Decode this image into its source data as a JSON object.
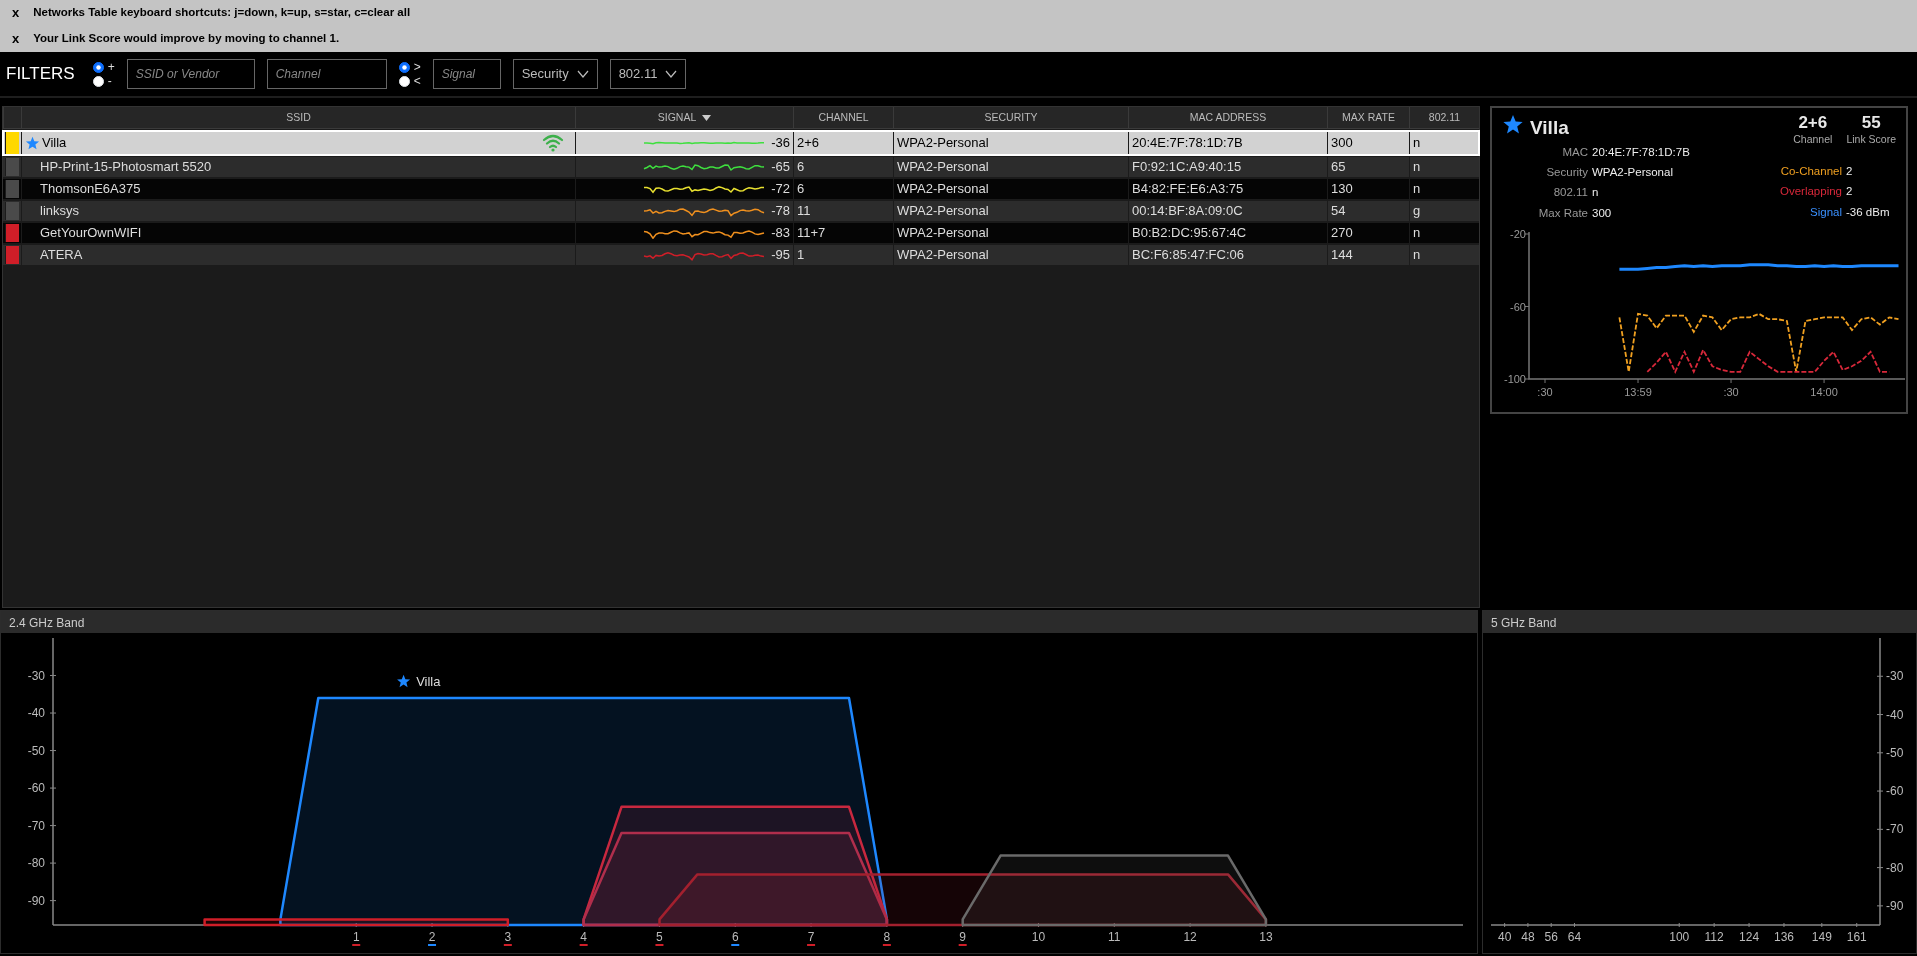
{
  "notifications": [
    {
      "close": "x",
      "text": "Networks Table keyboard shortcuts: j=down, k=up, s=star, c=clear all"
    },
    {
      "close": "x",
      "text": "Your Link Score would improve by moving to channel 1."
    }
  ],
  "filters": {
    "title": "FILTERS",
    "ssid_sign": [
      {
        "label": "+",
        "selected": true
      },
      {
        "label": "-",
        "selected": false
      }
    ],
    "ssid_field": {
      "placeholder": "SSID or Vendor"
    },
    "channel_field": {
      "placeholder": "Channel"
    },
    "signal_sign": [
      {
        "label": ">",
        "selected": true
      },
      {
        "label": "<",
        "selected": false
      }
    ],
    "signal_field": {
      "placeholder": "Signal"
    },
    "dropdowns": [
      "Security",
      "802.11"
    ]
  },
  "table": {
    "columns": [
      {
        "label": "SSID",
        "sorted": false
      },
      {
        "label": "SIGNAL",
        "sorted": true
      },
      {
        "label": "CHANNEL",
        "sorted": false
      },
      {
        "label": "SECURITY",
        "sorted": false
      },
      {
        "label": "MAC ADDRESS",
        "sorted": false
      },
      {
        "label": "MAX RATE",
        "sorted": false
      },
      {
        "label": "802.11",
        "sorted": false
      }
    ],
    "rows": [
      {
        "selected": true,
        "color": "#ffd800",
        "starred": true,
        "ssid": "Villa",
        "connected": true,
        "trace": {
          "color": "#3ee03e"
        },
        "signal": "-36",
        "channel": "2+6",
        "security": "WPA2-Personal",
        "mac": "20:4E:7F:78:1D:7B",
        "max_rate": "300",
        "phy": "n"
      },
      {
        "selected": false,
        "color": "#4a4a4a",
        "starred": false,
        "ssid": "HP-Print-15-Photosmart 5520",
        "connected": false,
        "trace": {
          "color": "#3ee03e"
        },
        "signal": "-65",
        "channel": "6",
        "security": "WPA2-Personal",
        "mac": "F0:92:1C:A9:40:15",
        "max_rate": "65",
        "phy": "n"
      },
      {
        "selected": false,
        "color": "#4a4a4a",
        "starred": false,
        "ssid": "ThomsonE6A375",
        "connected": false,
        "trace": {
          "color": "#e8e030"
        },
        "signal": "-72",
        "channel": "6",
        "security": "WPA2-Personal",
        "mac": "B4:82:FE:E6:A3:75",
        "max_rate": "130",
        "phy": "n"
      },
      {
        "selected": false,
        "color": "#4a4a4a",
        "starred": false,
        "ssid": "linksys",
        "connected": false,
        "trace": {
          "color": "#f0901e"
        },
        "signal": "-78",
        "channel": "11",
        "security": "WPA2-Personal",
        "mac": "00:14:BF:8A:09:0C",
        "max_rate": "54",
        "phy": "g"
      },
      {
        "selected": false,
        "color": "#d01e28",
        "starred": false,
        "ssid": "GetYourOwnWIFI",
        "connected": false,
        "trace": {
          "color": "#f0901e"
        },
        "signal": "-83",
        "channel": "11+7",
        "security": "WPA2-Personal",
        "mac": "B0:B2:DC:95:67:4C",
        "max_rate": "270",
        "phy": "n"
      },
      {
        "selected": false,
        "color": "#d01e28",
        "starred": false,
        "ssid": "ATERA",
        "connected": false,
        "trace": {
          "color": "#d01e28"
        },
        "signal": "-95",
        "channel": "1",
        "security": "WPA2-Personal",
        "mac": "BC:F6:85:47:FC:06",
        "max_rate": "144",
        "phy": "n"
      }
    ]
  },
  "details": {
    "starred": true,
    "ssid": "Villa",
    "channel": "2+6",
    "channel_label": "Channel",
    "link_score": "55",
    "link_score_label": "Link Score",
    "fields": [
      {
        "label": "MAC",
        "value": "20:4E:7F:78:1D:7B"
      },
      {
        "label": "Security",
        "value": "WPA2-Personal"
      },
      {
        "label": "802.11",
        "value": "n"
      },
      {
        "label": "Max Rate",
        "value": "300"
      }
    ],
    "stats": [
      {
        "label": "Co-Channel",
        "value": "2",
        "color": "#f0a020"
      },
      {
        "label": "Overlapping",
        "value": "2",
        "color": "#d8283a"
      },
      {
        "label": "Signal",
        "value": "-36 dBm",
        "color": "#3a90ff"
      }
    ],
    "chart_data": {
      "type": "line",
      "ylim": [
        -100,
        -20
      ],
      "yticks": [
        -20,
        -60,
        -100
      ],
      "categories": [
        ":30",
        null,
        null,
        null,
        null,
        null,
        null,
        null,
        null,
        null,
        "13:59",
        null,
        null,
        null,
        null,
        null,
        null,
        null,
        null,
        null,
        ":30",
        null,
        null,
        null,
        null,
        null,
        null,
        null,
        null,
        null,
        "14:00",
        null,
        null,
        null,
        null,
        null,
        null,
        null,
        null
      ],
      "series": [
        {
          "color": "#1e88ff",
          "line_style": "solid",
          "values": [
            null,
            null,
            null,
            null,
            null,
            null,
            null,
            null,
            -39.5,
            -39.5,
            -39.5,
            -39,
            -38.5,
            -38.5,
            -38,
            -37.5,
            -38,
            -37.5,
            -38,
            -37.5,
            -37.5,
            -37.5,
            -37,
            -37,
            -37,
            -37.5,
            -37.5,
            -38,
            -38,
            -37.5,
            -38,
            -37.5,
            -38,
            -38,
            -37.5,
            -37.5,
            -37.5,
            -37.5,
            -37.5
          ]
        },
        {
          "color": "#f0a020",
          "line_style": "dashed",
          "values": [
            null,
            null,
            null,
            null,
            null,
            null,
            null,
            null,
            -66,
            -96,
            -64,
            -65,
            -72,
            -65,
            -65,
            -65,
            -74,
            -65,
            -66,
            -73,
            -67,
            -66,
            -66,
            -64,
            -67,
            -67,
            -68,
            -96,
            -68,
            -67,
            -66,
            -66,
            -66,
            -73,
            -67,
            -66,
            -70,
            -66,
            -67
          ]
        },
        {
          "color": "#d8283a",
          "line_style": "dashed",
          "values": [
            null,
            null,
            null,
            null,
            null,
            null,
            null,
            null,
            null,
            null,
            null,
            -96,
            -91,
            -85,
            -96,
            -85,
            -96,
            -84,
            -93,
            -95,
            -96,
            -96,
            -85,
            -89,
            -93,
            -96,
            -96,
            -96,
            -96,
            -96,
            -90,
            -85,
            -95,
            -93,
            -90,
            -85,
            -96,
            -96,
            null
          ]
        }
      ]
    }
  },
  "band_24": {
    "title": "2.4 GHz Band",
    "annotation_marks": [
      {
        "starred": true
      }
    ],
    "channel_marks": [
      {
        "color": "#d01e28"
      },
      {
        "color": "#1e88ff"
      },
      {
        "color": "#d01e28"
      },
      {
        "color": "#d01e28"
      },
      {
        "color": "#d01e28"
      },
      {
        "color": "#1e88ff"
      },
      {
        "color": "#d01e28"
      },
      {
        "color": "#d01e28"
      },
      {
        "color": "#d01e28"
      }
    ],
    "chart_data": {
      "type": "area",
      "xlim": [
        -3,
        15.6
      ],
      "ylim": [
        -96.5,
        -20
      ],
      "yticks": [
        -30,
        -40,
        -50,
        -60,
        -70,
        -80,
        -90
      ],
      "xticks": [
        1,
        2,
        3,
        4,
        5,
        6,
        7,
        8,
        9,
        10,
        11,
        12,
        13
      ],
      "x": [
        -1,
        -0.5,
        0,
        0.5,
        1,
        1.5,
        2,
        2.5,
        3,
        3.5,
        4,
        4.5,
        5,
        5.5,
        6,
        6.5,
        7,
        7.5,
        8,
        8.5,
        9,
        9.5,
        10,
        10.5,
        11,
        11.5,
        12,
        12.5,
        13
      ],
      "series": [
        {
          "color": "#1e88ff",
          "values": [
            null,
            null,
            -95,
            -36,
            -36,
            -36,
            -36,
            -36,
            -36,
            -36,
            -36,
            -36,
            -36,
            -36,
            -36,
            -36,
            -36,
            -36,
            -95,
            null,
            null,
            null,
            null,
            null,
            null,
            null,
            null,
            null,
            null
          ]
        },
        {
          "color": "#c8283f",
          "values": [
            null,
            null,
            null,
            null,
            null,
            null,
            null,
            null,
            null,
            null,
            -95,
            -65,
            -65,
            -65,
            -65,
            -65,
            -65,
            -65,
            -95,
            null,
            null,
            null,
            null,
            null,
            null,
            null,
            null,
            null,
            null
          ]
        },
        {
          "color": "#b02e4c",
          "values": [
            null,
            null,
            null,
            null,
            null,
            null,
            null,
            null,
            null,
            null,
            -95,
            -72,
            -72,
            -72,
            -72,
            -72,
            -72,
            -72,
            -95,
            null,
            null,
            null,
            null,
            null,
            null,
            null,
            null,
            null,
            null
          ]
        },
        {
          "color": "#a3202e",
          "values": [
            null,
            null,
            null,
            null,
            null,
            null,
            null,
            null,
            null,
            null,
            null,
            null,
            -95,
            -83,
            -83,
            -83,
            -83,
            -83,
            -83,
            -83,
            -83,
            -83,
            -83,
            -83,
            -83,
            -83,
            -83,
            -83,
            -95
          ]
        },
        {
          "color": "#6a6a6a",
          "values": [
            null,
            null,
            null,
            null,
            null,
            null,
            null,
            null,
            null,
            null,
            null,
            null,
            null,
            null,
            null,
            null,
            null,
            null,
            null,
            null,
            -95,
            -78,
            -78,
            -78,
            -78,
            -78,
            -78,
            -78,
            -95
          ]
        },
        {
          "color": "#d01e28",
          "values": [
            -95,
            -95,
            -95,
            -95,
            -95,
            -95,
            -95,
            -95,
            -95,
            null,
            null,
            null,
            null,
            null,
            null,
            null,
            null,
            null,
            null,
            null,
            null,
            null,
            null,
            null,
            null,
            null,
            null,
            null,
            null
          ]
        }
      ],
      "annotations": [
        {
          "text": "Villa",
          "x": 1.5,
          "y": -36
        }
      ]
    }
  },
  "band_5": {
    "title": "5 GHz Band",
    "chart_data": {
      "type": "area",
      "xlim": [
        36,
        169
      ],
      "ylim": [
        -95,
        -20
      ],
      "yticks": [
        -30,
        -40,
        -50,
        -60,
        -70,
        -80,
        -90
      ],
      "xticks": [
        40,
        48,
        56,
        64,
        100,
        112,
        124,
        136,
        149,
        161
      ]
    }
  }
}
